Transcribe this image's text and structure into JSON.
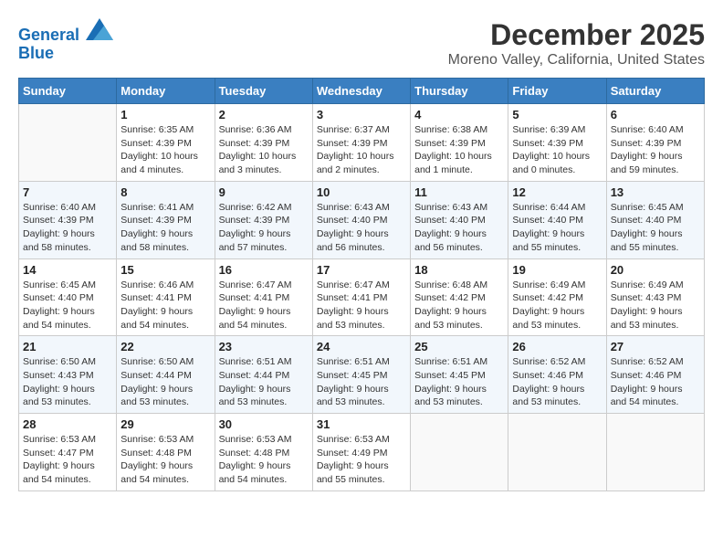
{
  "header": {
    "logo_line1": "General",
    "logo_line2": "Blue",
    "title": "December 2025",
    "subtitle": "Moreno Valley, California, United States"
  },
  "weekdays": [
    "Sunday",
    "Monday",
    "Tuesday",
    "Wednesday",
    "Thursday",
    "Friday",
    "Saturday"
  ],
  "weeks": [
    [
      {
        "day": "",
        "empty": true
      },
      {
        "day": "1",
        "sunrise": "Sunrise: 6:35 AM",
        "sunset": "Sunset: 4:39 PM",
        "daylight": "Daylight: 10 hours and 4 minutes."
      },
      {
        "day": "2",
        "sunrise": "Sunrise: 6:36 AM",
        "sunset": "Sunset: 4:39 PM",
        "daylight": "Daylight: 10 hours and 3 minutes."
      },
      {
        "day": "3",
        "sunrise": "Sunrise: 6:37 AM",
        "sunset": "Sunset: 4:39 PM",
        "daylight": "Daylight: 10 hours and 2 minutes."
      },
      {
        "day": "4",
        "sunrise": "Sunrise: 6:38 AM",
        "sunset": "Sunset: 4:39 PM",
        "daylight": "Daylight: 10 hours and 1 minute."
      },
      {
        "day": "5",
        "sunrise": "Sunrise: 6:39 AM",
        "sunset": "Sunset: 4:39 PM",
        "daylight": "Daylight: 10 hours and 0 minutes."
      },
      {
        "day": "6",
        "sunrise": "Sunrise: 6:40 AM",
        "sunset": "Sunset: 4:39 PM",
        "daylight": "Daylight: 9 hours and 59 minutes."
      }
    ],
    [
      {
        "day": "7",
        "sunrise": "Sunrise: 6:40 AM",
        "sunset": "Sunset: 4:39 PM",
        "daylight": "Daylight: 9 hours and 58 minutes."
      },
      {
        "day": "8",
        "sunrise": "Sunrise: 6:41 AM",
        "sunset": "Sunset: 4:39 PM",
        "daylight": "Daylight: 9 hours and 58 minutes."
      },
      {
        "day": "9",
        "sunrise": "Sunrise: 6:42 AM",
        "sunset": "Sunset: 4:39 PM",
        "daylight": "Daylight: 9 hours and 57 minutes."
      },
      {
        "day": "10",
        "sunrise": "Sunrise: 6:43 AM",
        "sunset": "Sunset: 4:40 PM",
        "daylight": "Daylight: 9 hours and 56 minutes."
      },
      {
        "day": "11",
        "sunrise": "Sunrise: 6:43 AM",
        "sunset": "Sunset: 4:40 PM",
        "daylight": "Daylight: 9 hours and 56 minutes."
      },
      {
        "day": "12",
        "sunrise": "Sunrise: 6:44 AM",
        "sunset": "Sunset: 4:40 PM",
        "daylight": "Daylight: 9 hours and 55 minutes."
      },
      {
        "day": "13",
        "sunrise": "Sunrise: 6:45 AM",
        "sunset": "Sunset: 4:40 PM",
        "daylight": "Daylight: 9 hours and 55 minutes."
      }
    ],
    [
      {
        "day": "14",
        "sunrise": "Sunrise: 6:45 AM",
        "sunset": "Sunset: 4:40 PM",
        "daylight": "Daylight: 9 hours and 54 minutes."
      },
      {
        "day": "15",
        "sunrise": "Sunrise: 6:46 AM",
        "sunset": "Sunset: 4:41 PM",
        "daylight": "Daylight: 9 hours and 54 minutes."
      },
      {
        "day": "16",
        "sunrise": "Sunrise: 6:47 AM",
        "sunset": "Sunset: 4:41 PM",
        "daylight": "Daylight: 9 hours and 54 minutes."
      },
      {
        "day": "17",
        "sunrise": "Sunrise: 6:47 AM",
        "sunset": "Sunset: 4:41 PM",
        "daylight": "Daylight: 9 hours and 53 minutes."
      },
      {
        "day": "18",
        "sunrise": "Sunrise: 6:48 AM",
        "sunset": "Sunset: 4:42 PM",
        "daylight": "Daylight: 9 hours and 53 minutes."
      },
      {
        "day": "19",
        "sunrise": "Sunrise: 6:49 AM",
        "sunset": "Sunset: 4:42 PM",
        "daylight": "Daylight: 9 hours and 53 minutes."
      },
      {
        "day": "20",
        "sunrise": "Sunrise: 6:49 AM",
        "sunset": "Sunset: 4:43 PM",
        "daylight": "Daylight: 9 hours and 53 minutes."
      }
    ],
    [
      {
        "day": "21",
        "sunrise": "Sunrise: 6:50 AM",
        "sunset": "Sunset: 4:43 PM",
        "daylight": "Daylight: 9 hours and 53 minutes."
      },
      {
        "day": "22",
        "sunrise": "Sunrise: 6:50 AM",
        "sunset": "Sunset: 4:44 PM",
        "daylight": "Daylight: 9 hours and 53 minutes."
      },
      {
        "day": "23",
        "sunrise": "Sunrise: 6:51 AM",
        "sunset": "Sunset: 4:44 PM",
        "daylight": "Daylight: 9 hours and 53 minutes."
      },
      {
        "day": "24",
        "sunrise": "Sunrise: 6:51 AM",
        "sunset": "Sunset: 4:45 PM",
        "daylight": "Daylight: 9 hours and 53 minutes."
      },
      {
        "day": "25",
        "sunrise": "Sunrise: 6:51 AM",
        "sunset": "Sunset: 4:45 PM",
        "daylight": "Daylight: 9 hours and 53 minutes."
      },
      {
        "day": "26",
        "sunrise": "Sunrise: 6:52 AM",
        "sunset": "Sunset: 4:46 PM",
        "daylight": "Daylight: 9 hours and 53 minutes."
      },
      {
        "day": "27",
        "sunrise": "Sunrise: 6:52 AM",
        "sunset": "Sunset: 4:46 PM",
        "daylight": "Daylight: 9 hours and 54 minutes."
      }
    ],
    [
      {
        "day": "28",
        "sunrise": "Sunrise: 6:53 AM",
        "sunset": "Sunset: 4:47 PM",
        "daylight": "Daylight: 9 hours and 54 minutes."
      },
      {
        "day": "29",
        "sunrise": "Sunrise: 6:53 AM",
        "sunset": "Sunset: 4:48 PM",
        "daylight": "Daylight: 9 hours and 54 minutes."
      },
      {
        "day": "30",
        "sunrise": "Sunrise: 6:53 AM",
        "sunset": "Sunset: 4:48 PM",
        "daylight": "Daylight: 9 hours and 54 minutes."
      },
      {
        "day": "31",
        "sunrise": "Sunrise: 6:53 AM",
        "sunset": "Sunset: 4:49 PM",
        "daylight": "Daylight: 9 hours and 55 minutes."
      },
      {
        "day": "",
        "empty": true
      },
      {
        "day": "",
        "empty": true
      },
      {
        "day": "",
        "empty": true
      }
    ]
  ]
}
